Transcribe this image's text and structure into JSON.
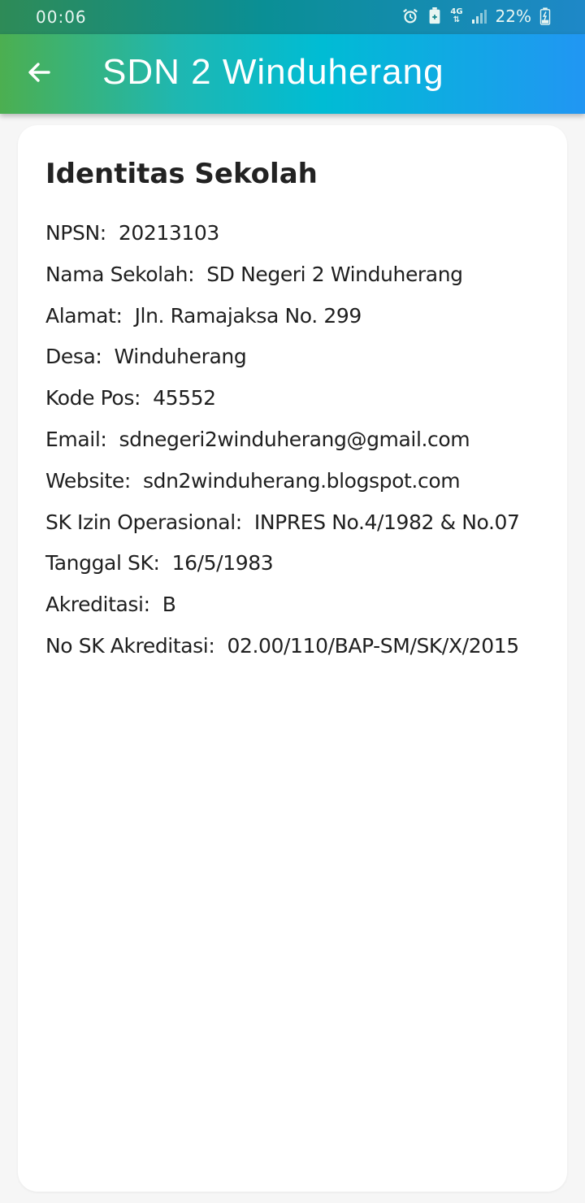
{
  "status_bar": {
    "time": "00:06",
    "icons": [
      "alarm-icon",
      "battery-saver-icon",
      "network-4g-icon",
      "signal-icon",
      "battery-charging-icon"
    ],
    "network_label": "4G",
    "battery": "22%"
  },
  "app_bar": {
    "back_icon": "arrow-left-icon",
    "title": "SDN 2 Winduherang"
  },
  "card": {
    "title": "Identitas Sekolah",
    "rows": [
      {
        "label": "NPSN:",
        "value": "20213103"
      },
      {
        "label": "Nama Sekolah:",
        "value": "SD Negeri 2 Winduherang"
      },
      {
        "label": "Alamat:",
        "value": "Jln. Ramajaksa No. 299"
      },
      {
        "label": "Desa:",
        "value": "Winduherang"
      },
      {
        "label": "Kode Pos:",
        "value": "45552"
      },
      {
        "label": "Email:",
        "value": "sdnegeri2winduherang@gmail.com"
      },
      {
        "label": "Website:",
        "value": "sdn2winduherang.blogspot.com"
      },
      {
        "label": "SK Izin Operasional:",
        "value": "INPRES No.4/1982 & No.07"
      },
      {
        "label": "Tanggal SK:",
        "value": "16/5/1983"
      },
      {
        "label": "Akreditasi:",
        "value": "B"
      },
      {
        "label": "No SK Akreditasi:",
        "value": "02.00/110/BAP-SM/SK/X/2015"
      }
    ]
  },
  "colors": {
    "appbar_start": "#4caf50",
    "appbar_mid": "#00bcd4",
    "appbar_end": "#2196f3",
    "background": "#f6f6f6",
    "card": "#ffffff",
    "text": "#1f1f1f"
  }
}
